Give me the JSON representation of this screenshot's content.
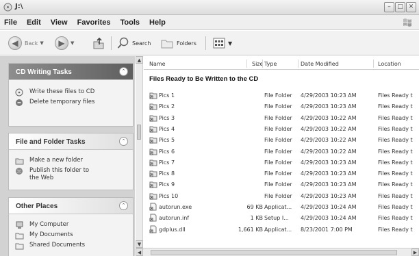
{
  "window": {
    "title": "J:\\"
  },
  "menu": [
    "File",
    "Edit",
    "View",
    "Favorites",
    "Tools",
    "Help"
  ],
  "toolbar": {
    "back_label": "Back",
    "search_label": "Search",
    "folders_label": "Folders"
  },
  "tasks": {
    "cd": {
      "title": "CD Writing Tasks",
      "items": [
        "Write these files to CD",
        "Delete temporary files"
      ]
    },
    "file": {
      "title": "File and Folder Tasks",
      "items": [
        "Make a new folder",
        "Publish this folder to the Web"
      ]
    },
    "places": {
      "title": "Other Places",
      "items": [
        "My Computer",
        "My Documents",
        "Shared Documents"
      ]
    }
  },
  "list": {
    "columns": [
      "Name",
      "Size",
      "Type",
      "Date Modified",
      "Location"
    ],
    "group_header": "Files Ready to Be Written to the CD",
    "rows": [
      {
        "name": "Pics 1",
        "size": "",
        "type": "File Folder",
        "date": "4/29/2003 10:23 AM",
        "location": "Files Ready t"
      },
      {
        "name": "Pics 2",
        "size": "",
        "type": "File Folder",
        "date": "4/29/2003 10:23 AM",
        "location": "Files Ready t"
      },
      {
        "name": "Pics 3",
        "size": "",
        "type": "File Folder",
        "date": "4/29/2003 10:22 AM",
        "location": "Files Ready t"
      },
      {
        "name": "Pics 4",
        "size": "",
        "type": "File Folder",
        "date": "4/29/2003 10:22 AM",
        "location": "Files Ready t"
      },
      {
        "name": "Pics 5",
        "size": "",
        "type": "File Folder",
        "date": "4/29/2003 10:22 AM",
        "location": "Files Ready t"
      },
      {
        "name": "Pics 6",
        "size": "",
        "type": "File Folder",
        "date": "4/29/2003 10:22 AM",
        "location": "Files Ready t"
      },
      {
        "name": "Pics 7",
        "size": "",
        "type": "File Folder",
        "date": "4/29/2003 10:23 AM",
        "location": "Files Ready t"
      },
      {
        "name": "Pics 8",
        "size": "",
        "type": "File Folder",
        "date": "4/29/2003 10:23 AM",
        "location": "Files Ready t"
      },
      {
        "name": "Pics 9",
        "size": "",
        "type": "File Folder",
        "date": "4/29/2003 10:23 AM",
        "location": "Files Ready t"
      },
      {
        "name": "Pics 10",
        "size": "",
        "type": "File Folder",
        "date": "4/29/2003 10:23 AM",
        "location": "Files Ready t"
      },
      {
        "name": "autorun.exe",
        "size": "69 KB",
        "type": "Applicat...",
        "date": "4/29/2003 10:24 AM",
        "location": "Files Ready t"
      },
      {
        "name": "autorun.inf",
        "size": "1 KB",
        "type": "Setup I...",
        "date": "4/29/2003 10:24 AM",
        "location": "Files Ready t"
      },
      {
        "name": "gdplus.dll",
        "size": "1,661 KB",
        "type": "Applicat...",
        "date": "8/23/2001 7:00 PM",
        "location": "Files Ready t"
      }
    ]
  }
}
